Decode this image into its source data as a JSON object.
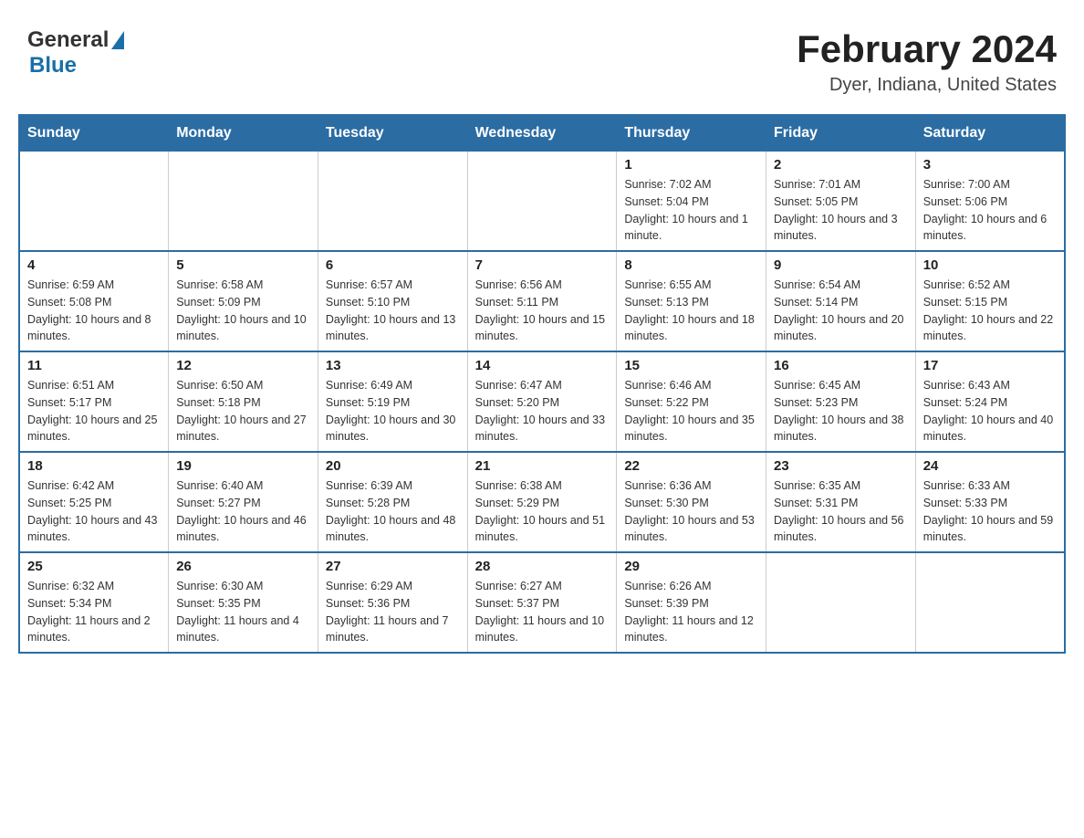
{
  "header": {
    "logo_general": "General",
    "logo_blue": "Blue",
    "title": "February 2024",
    "location": "Dyer, Indiana, United States"
  },
  "calendar": {
    "days_of_week": [
      "Sunday",
      "Monday",
      "Tuesday",
      "Wednesday",
      "Thursday",
      "Friday",
      "Saturday"
    ],
    "weeks": [
      [
        {
          "day": "",
          "info": ""
        },
        {
          "day": "",
          "info": ""
        },
        {
          "day": "",
          "info": ""
        },
        {
          "day": "",
          "info": ""
        },
        {
          "day": "1",
          "info": "Sunrise: 7:02 AM\nSunset: 5:04 PM\nDaylight: 10 hours and 1 minute."
        },
        {
          "day": "2",
          "info": "Sunrise: 7:01 AM\nSunset: 5:05 PM\nDaylight: 10 hours and 3 minutes."
        },
        {
          "day": "3",
          "info": "Sunrise: 7:00 AM\nSunset: 5:06 PM\nDaylight: 10 hours and 6 minutes."
        }
      ],
      [
        {
          "day": "4",
          "info": "Sunrise: 6:59 AM\nSunset: 5:08 PM\nDaylight: 10 hours and 8 minutes."
        },
        {
          "day": "5",
          "info": "Sunrise: 6:58 AM\nSunset: 5:09 PM\nDaylight: 10 hours and 10 minutes."
        },
        {
          "day": "6",
          "info": "Sunrise: 6:57 AM\nSunset: 5:10 PM\nDaylight: 10 hours and 13 minutes."
        },
        {
          "day": "7",
          "info": "Sunrise: 6:56 AM\nSunset: 5:11 PM\nDaylight: 10 hours and 15 minutes."
        },
        {
          "day": "8",
          "info": "Sunrise: 6:55 AM\nSunset: 5:13 PM\nDaylight: 10 hours and 18 minutes."
        },
        {
          "day": "9",
          "info": "Sunrise: 6:54 AM\nSunset: 5:14 PM\nDaylight: 10 hours and 20 minutes."
        },
        {
          "day": "10",
          "info": "Sunrise: 6:52 AM\nSunset: 5:15 PM\nDaylight: 10 hours and 22 minutes."
        }
      ],
      [
        {
          "day": "11",
          "info": "Sunrise: 6:51 AM\nSunset: 5:17 PM\nDaylight: 10 hours and 25 minutes."
        },
        {
          "day": "12",
          "info": "Sunrise: 6:50 AM\nSunset: 5:18 PM\nDaylight: 10 hours and 27 minutes."
        },
        {
          "day": "13",
          "info": "Sunrise: 6:49 AM\nSunset: 5:19 PM\nDaylight: 10 hours and 30 minutes."
        },
        {
          "day": "14",
          "info": "Sunrise: 6:47 AM\nSunset: 5:20 PM\nDaylight: 10 hours and 33 minutes."
        },
        {
          "day": "15",
          "info": "Sunrise: 6:46 AM\nSunset: 5:22 PM\nDaylight: 10 hours and 35 minutes."
        },
        {
          "day": "16",
          "info": "Sunrise: 6:45 AM\nSunset: 5:23 PM\nDaylight: 10 hours and 38 minutes."
        },
        {
          "day": "17",
          "info": "Sunrise: 6:43 AM\nSunset: 5:24 PM\nDaylight: 10 hours and 40 minutes."
        }
      ],
      [
        {
          "day": "18",
          "info": "Sunrise: 6:42 AM\nSunset: 5:25 PM\nDaylight: 10 hours and 43 minutes."
        },
        {
          "day": "19",
          "info": "Sunrise: 6:40 AM\nSunset: 5:27 PM\nDaylight: 10 hours and 46 minutes."
        },
        {
          "day": "20",
          "info": "Sunrise: 6:39 AM\nSunset: 5:28 PM\nDaylight: 10 hours and 48 minutes."
        },
        {
          "day": "21",
          "info": "Sunrise: 6:38 AM\nSunset: 5:29 PM\nDaylight: 10 hours and 51 minutes."
        },
        {
          "day": "22",
          "info": "Sunrise: 6:36 AM\nSunset: 5:30 PM\nDaylight: 10 hours and 53 minutes."
        },
        {
          "day": "23",
          "info": "Sunrise: 6:35 AM\nSunset: 5:31 PM\nDaylight: 10 hours and 56 minutes."
        },
        {
          "day": "24",
          "info": "Sunrise: 6:33 AM\nSunset: 5:33 PM\nDaylight: 10 hours and 59 minutes."
        }
      ],
      [
        {
          "day": "25",
          "info": "Sunrise: 6:32 AM\nSunset: 5:34 PM\nDaylight: 11 hours and 2 minutes."
        },
        {
          "day": "26",
          "info": "Sunrise: 6:30 AM\nSunset: 5:35 PM\nDaylight: 11 hours and 4 minutes."
        },
        {
          "day": "27",
          "info": "Sunrise: 6:29 AM\nSunset: 5:36 PM\nDaylight: 11 hours and 7 minutes."
        },
        {
          "day": "28",
          "info": "Sunrise: 6:27 AM\nSunset: 5:37 PM\nDaylight: 11 hours and 10 minutes."
        },
        {
          "day": "29",
          "info": "Sunrise: 6:26 AM\nSunset: 5:39 PM\nDaylight: 11 hours and 12 minutes."
        },
        {
          "day": "",
          "info": ""
        },
        {
          "day": "",
          "info": ""
        }
      ]
    ]
  }
}
